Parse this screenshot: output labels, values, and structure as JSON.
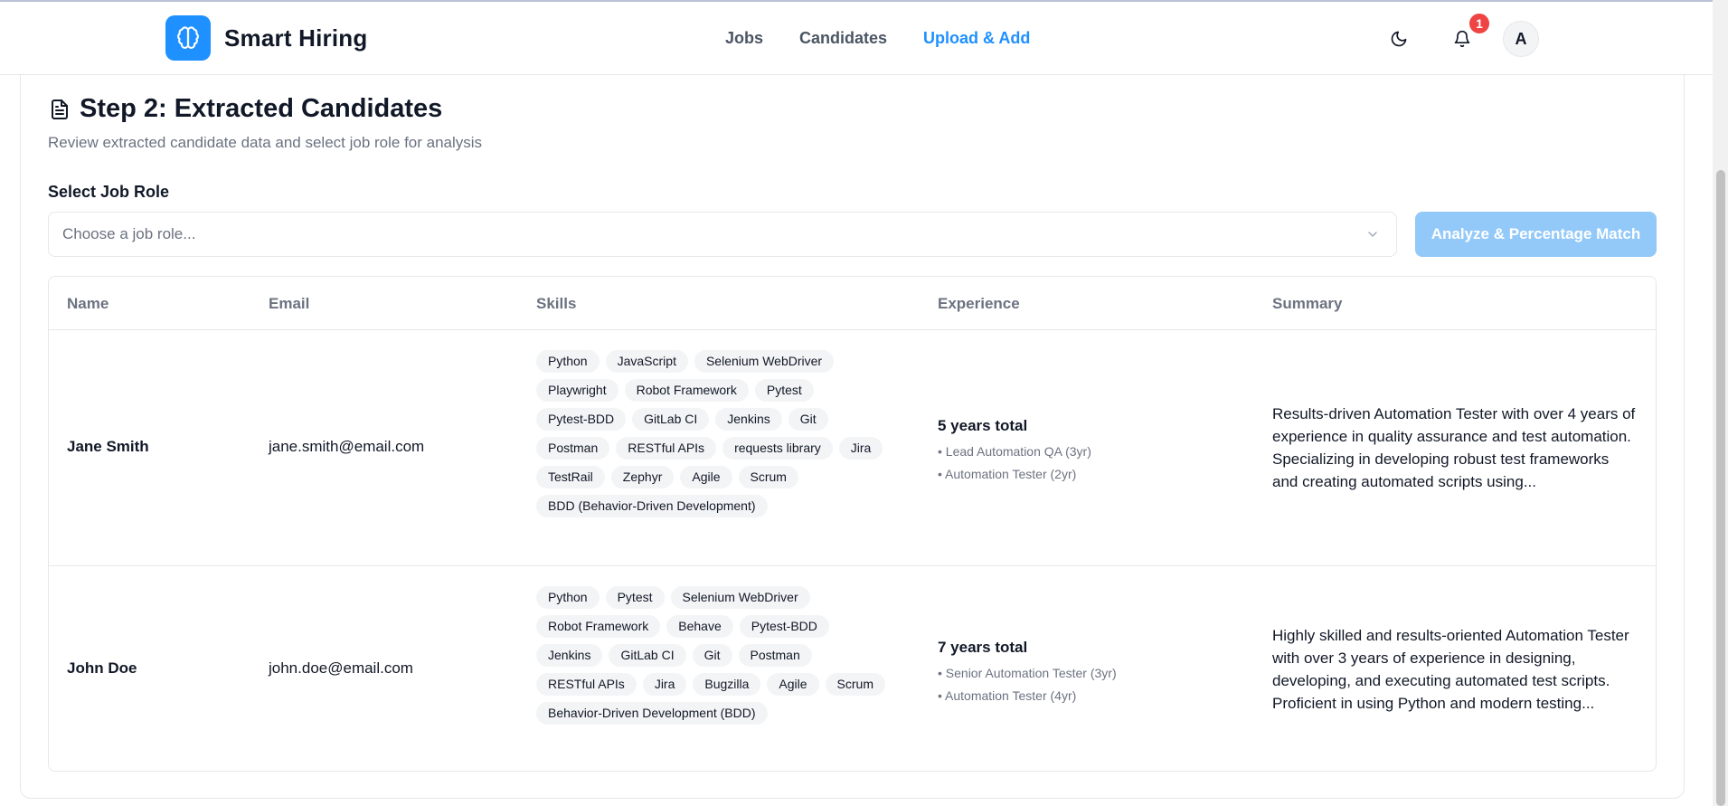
{
  "header": {
    "brand": "Smart Hiring",
    "nav": [
      {
        "label": "Jobs"
      },
      {
        "label": "Candidates"
      },
      {
        "label": "Upload & Add"
      }
    ],
    "notifications_count": "1",
    "avatar_initial": "A",
    "accent_color": "#1e90ff"
  },
  "step": {
    "title": "Step 2: Extracted Candidates",
    "subtitle": "Review extracted candidate data and select job role for analysis",
    "select_label": "Select Job Role",
    "select_placeholder": "Choose a job role...",
    "analyze_button": "Analyze & Percentage Match"
  },
  "table": {
    "headers": [
      "Name",
      "Email",
      "Skills",
      "Experience",
      "Summary"
    ],
    "rows": [
      {
        "name": "Jane Smith",
        "email": "jane.smith@email.com",
        "skills": [
          "Python",
          "JavaScript",
          "Selenium WebDriver",
          "Playwright",
          "Robot Framework",
          "Pytest",
          "Pytest-BDD",
          "GitLab CI",
          "Jenkins",
          "Git",
          "Postman",
          "RESTful APIs",
          "requests library",
          "Jira",
          "TestRail",
          "Zephyr",
          "Agile",
          "Scrum",
          "BDD (Behavior-Driven Development)"
        ],
        "experience_total": "5 years total",
        "experience_items": [
          "• Lead Automation QA (3yr)",
          "• Automation Tester (2yr)"
        ],
        "summary": "Results-driven Automation Tester with over 4 years of experience in quality assurance and test automation. Specializing in developing robust test frameworks and creating automated scripts using..."
      },
      {
        "name": "John Doe",
        "email": "john.doe@email.com",
        "skills": [
          "Python",
          "Pytest",
          "Selenium WebDriver",
          "Robot Framework",
          "Behave",
          "Pytest-BDD",
          "Jenkins",
          "GitLab CI",
          "Git",
          "Postman",
          "RESTful APIs",
          "Jira",
          "Bugzilla",
          "Agile",
          "Scrum",
          "Behavior-Driven Development (BDD)"
        ],
        "experience_total": "7 years total",
        "experience_items": [
          "• Senior Automation Tester (3yr)",
          "• Automation Tester (4yr)"
        ],
        "summary": "Highly skilled and results-oriented Automation Tester with over 3 years of experience in designing, developing, and executing automated test scripts. Proficient in using Python and modern testing..."
      }
    ]
  }
}
